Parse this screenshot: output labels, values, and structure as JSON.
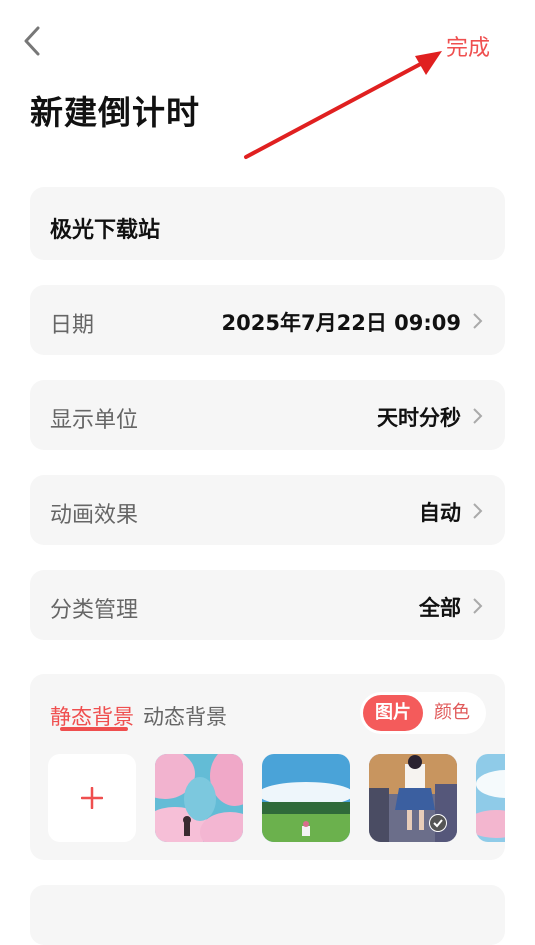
{
  "header": {
    "done_label": "完成",
    "page_title": "新建倒计时"
  },
  "event_name": "极光下载站",
  "settings": [
    {
      "label": "日期",
      "value": "2025年7月22日 09:09"
    },
    {
      "label": "显示单位",
      "value": "天时分秒"
    },
    {
      "label": "动画效果",
      "value": "自动"
    },
    {
      "label": "分类管理",
      "value": "全部"
    }
  ],
  "background": {
    "tabs": [
      {
        "label": "静态背景",
        "active": true
      },
      {
        "label": "动态背景",
        "active": false
      }
    ],
    "segment": {
      "image_label": "图片",
      "color_label": "颜色",
      "selected": "图片"
    },
    "add_icon": "plus-icon",
    "thumbnails": [
      {
        "name": "pink-clouds-girl",
        "selected": false
      },
      {
        "name": "green-field-sky",
        "selected": false
      },
      {
        "name": "sunset-city-girl",
        "selected": true
      },
      {
        "name": "blue-sky-partial",
        "selected": false
      }
    ]
  },
  "colors": {
    "accent": "#ef4f4f",
    "card_bg": "#f6f6f6",
    "arrow": "#e02020"
  }
}
